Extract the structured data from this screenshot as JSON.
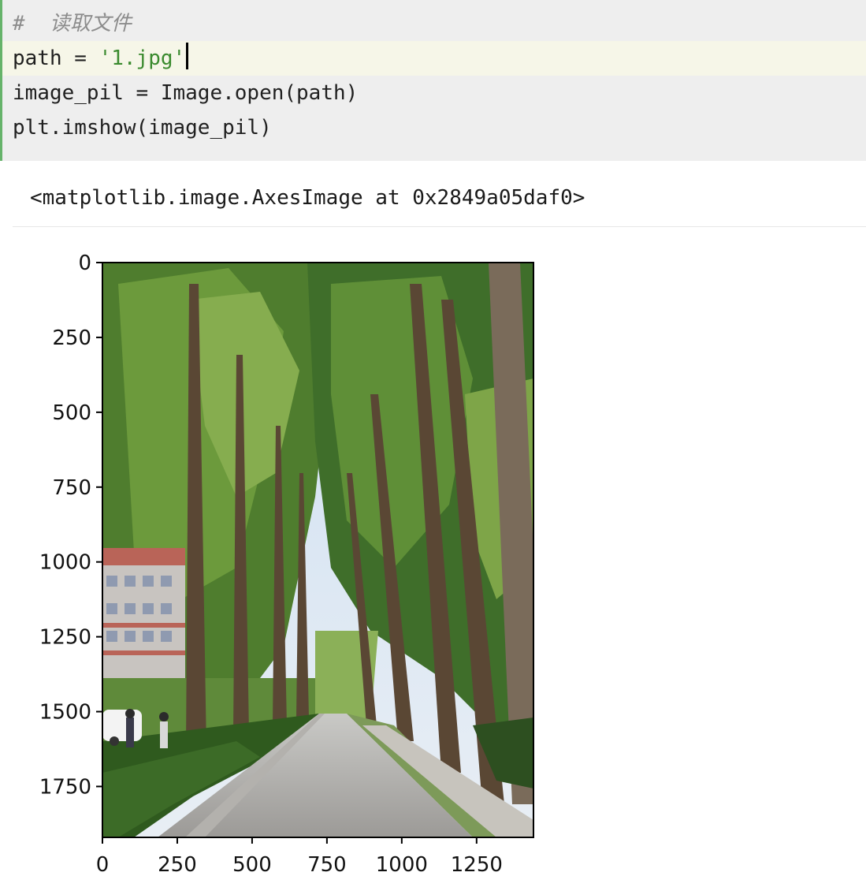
{
  "code_cell": {
    "comment_line": "#  读取文件",
    "line_path_prefix": "path = ",
    "line_path_string": "'1.jpg'",
    "line_open": "image_pil = Image.open(path)",
    "line_show": "plt.imshow(image_pil)"
  },
  "output": {
    "repr_text": "<matplotlib.image.AxesImage at 0x2849a05daf0>"
  },
  "colors": {
    "cell_background": "#eeeeee",
    "cell_bar": "#66b36a",
    "string": "#3a8a2e",
    "comment": "#8c8c8c"
  },
  "chart_data": {
    "type": "image",
    "xlim": [
      0,
      1440
    ],
    "ylim": [
      1920,
      0
    ],
    "x_ticks": [
      "0",
      "250",
      "500",
      "750",
      "1000",
      "1250"
    ],
    "y_ticks": [
      "0",
      "250",
      "500",
      "750",
      "1000",
      "1250",
      "1500",
      "1750"
    ],
    "x_tick_values": [
      0,
      250,
      500,
      750,
      1000,
      1250
    ],
    "y_tick_values": [
      0,
      250,
      500,
      750,
      1000,
      1250,
      1500,
      1750
    ],
    "image_subject": "tree-lined road photo"
  }
}
